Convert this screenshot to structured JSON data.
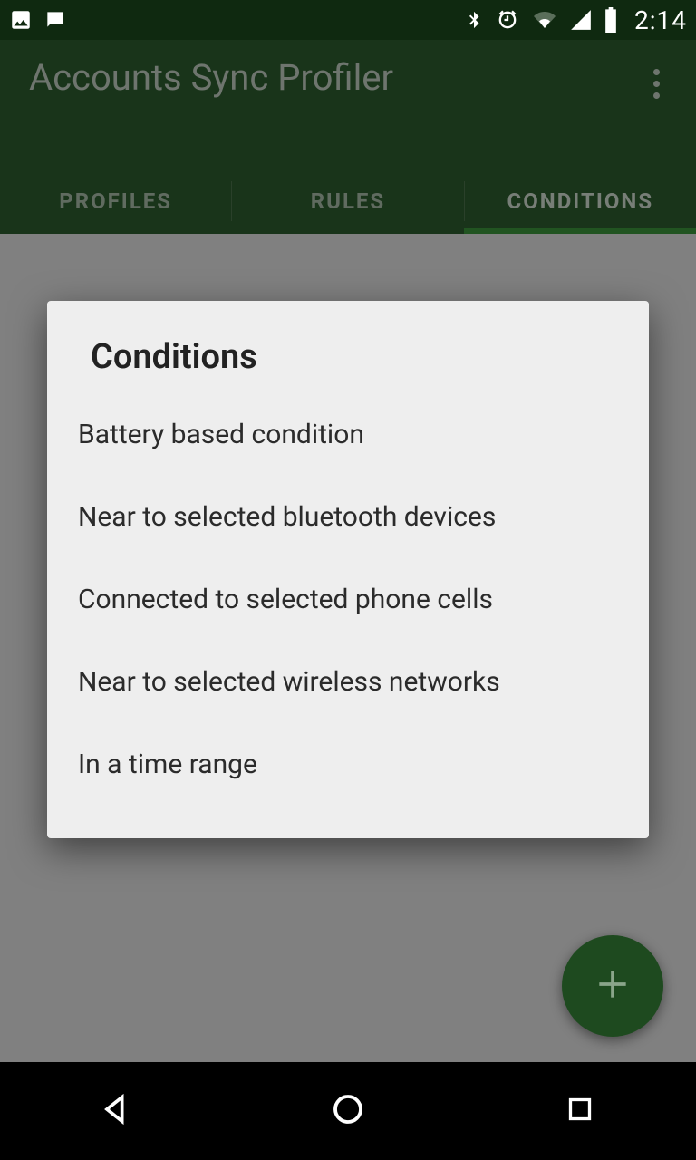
{
  "statusbar": {
    "time": "2:14"
  },
  "header": {
    "title": "Accounts Sync Profiler"
  },
  "tabs": [
    {
      "label": "PROFILES",
      "active": false
    },
    {
      "label": "RULES",
      "active": false
    },
    {
      "label": "CONDITIONS",
      "active": true
    }
  ],
  "dialog": {
    "title": "Conditions",
    "items": [
      "Battery based condition",
      "Near to selected bluetooth devices",
      "Connected to selected phone cells",
      "Near to selected wireless networks",
      "In a time range"
    ]
  }
}
